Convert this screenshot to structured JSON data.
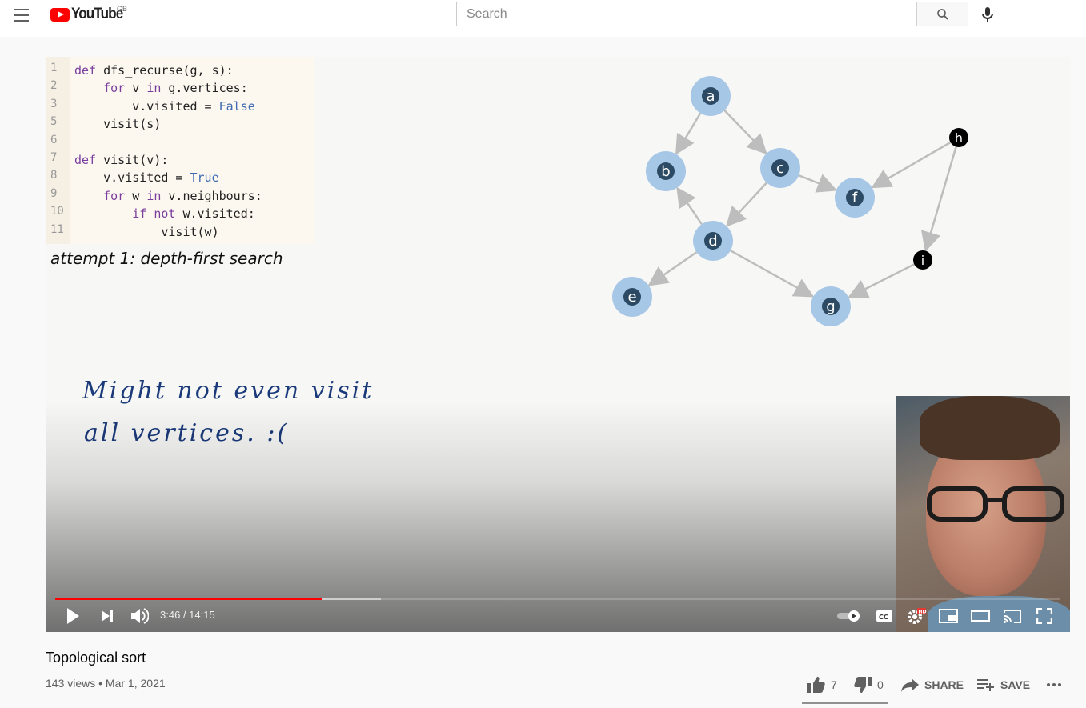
{
  "header": {
    "logo_text": "YouTube",
    "region": "GB",
    "search_placeholder": "Search",
    "icons": [
      "menu-icon",
      "search-icon",
      "microphone-icon"
    ]
  },
  "video": {
    "code": [
      {
        "ln": "1",
        "html": "<span class=\"kw\">def</span> dfs_recurse(g, s):"
      },
      {
        "ln": "2",
        "html": "    <span class=\"kw\">for</span> v <span class=\"kw\">in</span> g.vertices:"
      },
      {
        "ln": "3",
        "html": "        v.visited = <span class=\"bl\">False</span>"
      },
      {
        "ln": "5",
        "html": "    visit(s)"
      },
      {
        "ln": "6",
        "html": ""
      },
      {
        "ln": "7",
        "html": "<span class=\"kw\">def</span> visit(v):"
      },
      {
        "ln": "8",
        "html": "    v.visited = <span class=\"bl\">True</span>"
      },
      {
        "ln": "9",
        "html": "    <span class=\"kw\">for</span> w <span class=\"kw\">in</span> v.neighbours:"
      },
      {
        "ln": "10",
        "html": "        <span class=\"kw\">if</span> <span class=\"kw\">not</span> w.visited:"
      },
      {
        "ln": "11",
        "html": "            visit(w)"
      }
    ],
    "caption": "attempt 1: depth-first search",
    "handwriting": [
      "Might not even visit",
      "all vertices. :("
    ],
    "graph": {
      "visited_nodes": [
        "a",
        "b",
        "c",
        "d",
        "e",
        "f",
        "g"
      ],
      "unvisited_nodes": [
        "h",
        "i"
      ],
      "edges": [
        [
          "a",
          "b"
        ],
        [
          "a",
          "c"
        ],
        [
          "c",
          "f"
        ],
        [
          "c",
          "d"
        ],
        [
          "d",
          "b"
        ],
        [
          "d",
          "e"
        ],
        [
          "d",
          "g"
        ],
        [
          "h",
          "f"
        ],
        [
          "h",
          "i"
        ],
        [
          "i",
          "g"
        ]
      ],
      "colors": {
        "visited_fill": "#a7c7e7",
        "visited_core": "#2c4a63",
        "unvisited": "#000000",
        "edge": "#bdbdbd"
      }
    },
    "player": {
      "time": "3:46 / 14:15",
      "progress": 0.265,
      "buffered": 0.324,
      "accent": "#ff0000",
      "hd_badge": "HD",
      "icons": [
        "play-icon",
        "next-icon",
        "volume-icon",
        "autoplay-toggle-icon",
        "captions-icon",
        "settings-icon",
        "miniplayer-icon",
        "theater-icon",
        "cast-icon",
        "fullscreen-icon"
      ]
    }
  },
  "info": {
    "title": "Topological sort",
    "meta": "143 views • Mar 1, 2021",
    "likes": "7",
    "dislikes": "0",
    "share": "SHARE",
    "save": "SAVE"
  }
}
